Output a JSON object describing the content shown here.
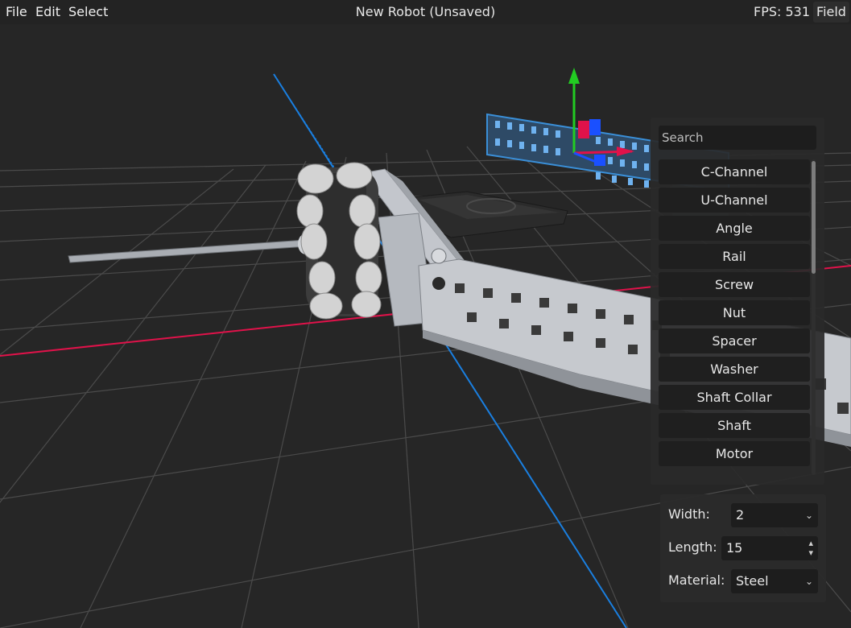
{
  "menu": {
    "file": "File",
    "edit": "Edit",
    "select": "Select"
  },
  "window_title": "New Robot (Unsaved)",
  "status": {
    "fps": "FPS: 531",
    "field_button": "Field"
  },
  "parts_panel": {
    "search_placeholder": "Search",
    "items": [
      {
        "label": "C-Channel"
      },
      {
        "label": "U-Channel"
      },
      {
        "label": "Angle"
      },
      {
        "label": "Rail"
      },
      {
        "label": "Screw"
      },
      {
        "label": "Nut"
      },
      {
        "label": "Spacer"
      },
      {
        "label": "Washer"
      },
      {
        "label": "Shaft Collar"
      },
      {
        "label": "Shaft"
      },
      {
        "label": "Motor"
      }
    ]
  },
  "properties": {
    "width_label": "Width:",
    "width_value": "2",
    "length_label": "Length:",
    "length_value": "15",
    "material_label": "Material:",
    "material_value": "Steel"
  },
  "colors": {
    "background": "#262626",
    "grid": "#4a4a4a",
    "x_axis": "#e0124a",
    "z_axis": "#1a7fe0",
    "gizmo_y": "#22cc22",
    "selection": "#3a8fd8",
    "metal": "#b8bcc4"
  },
  "icons": {
    "dropdown": "chevron-down-icon",
    "spinner": "spinner-arrows-icon"
  }
}
